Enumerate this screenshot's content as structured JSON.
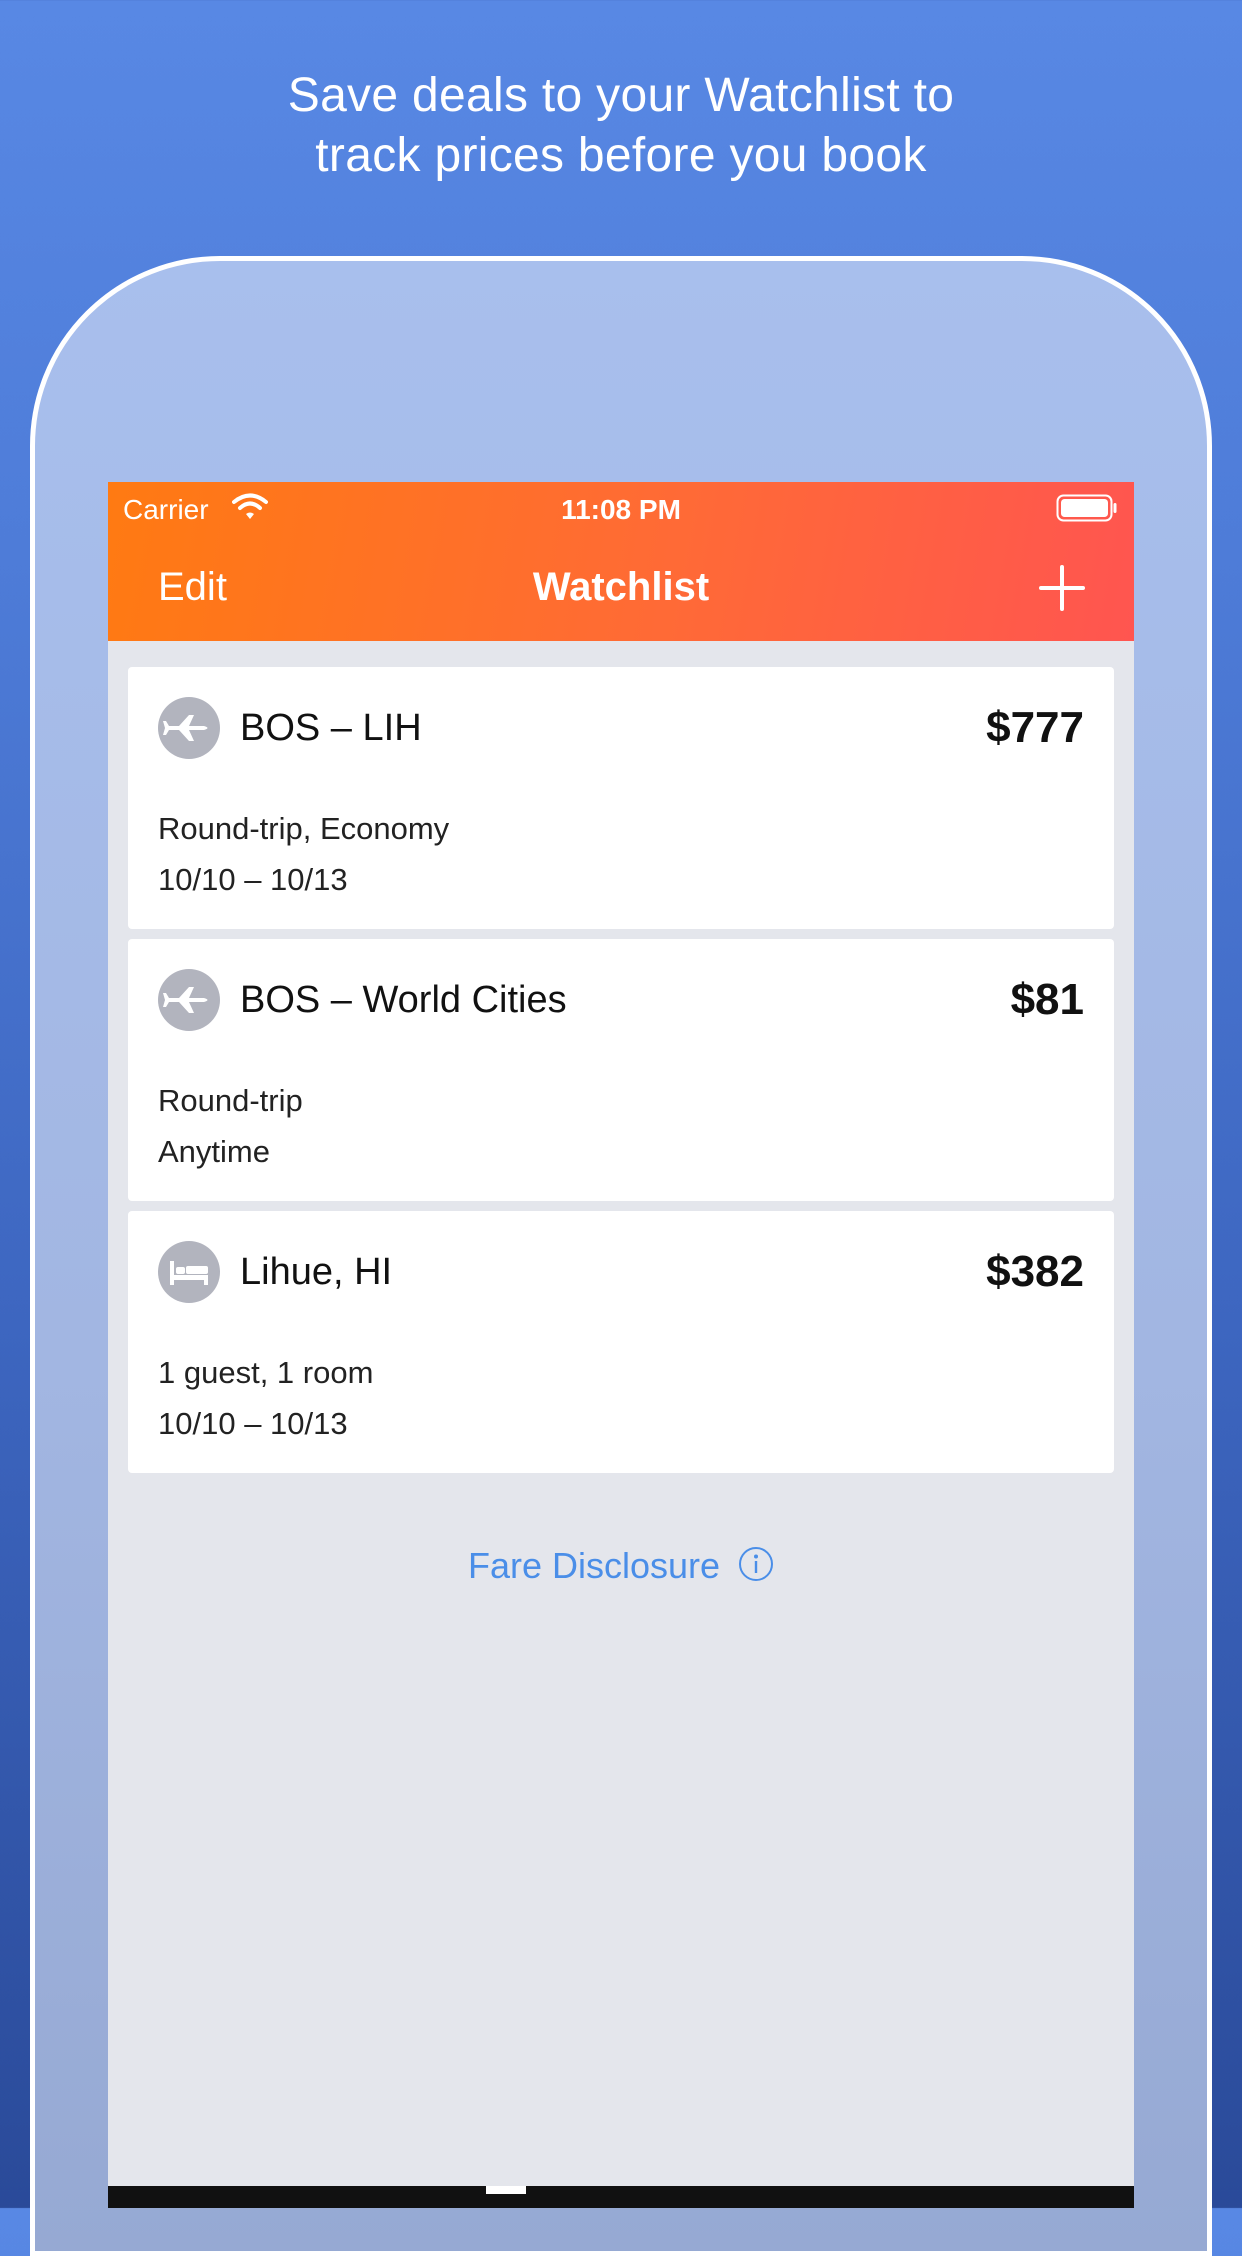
{
  "headline": {
    "line1": "Save deals to your Watchlist to",
    "line2": "track prices before you book"
  },
  "status_bar": {
    "carrier": "Carrier",
    "time": "11:08 PM",
    "icons": [
      "wifi-icon",
      "battery-icon"
    ]
  },
  "navbar": {
    "edit_label": "Edit",
    "title": "Watchlist",
    "add_icon": "plus-icon"
  },
  "watchlist": [
    {
      "icon": "airplane-icon",
      "title": "BOS – LIH",
      "price": "$777",
      "line1": "Round-trip, Economy",
      "line2": "10/10 – 10/13"
    },
    {
      "icon": "airplane-icon",
      "title": "BOS – World Cities",
      "price": "$81",
      "line1": "Round-trip",
      "line2": "Anytime"
    },
    {
      "icon": "bed-icon",
      "title": "Lihue, HI",
      "price": "$382",
      "line1": "1 guest, 1 room",
      "line2": "10/10 – 10/13"
    }
  ],
  "fare_disclosure": {
    "label": "Fare Disclosure",
    "icon": "info-icon"
  },
  "colors": {
    "navbar_start": "#ff7a12",
    "navbar_end": "#ff5550",
    "link": "#4a8ee8",
    "background": "#5888e4"
  }
}
